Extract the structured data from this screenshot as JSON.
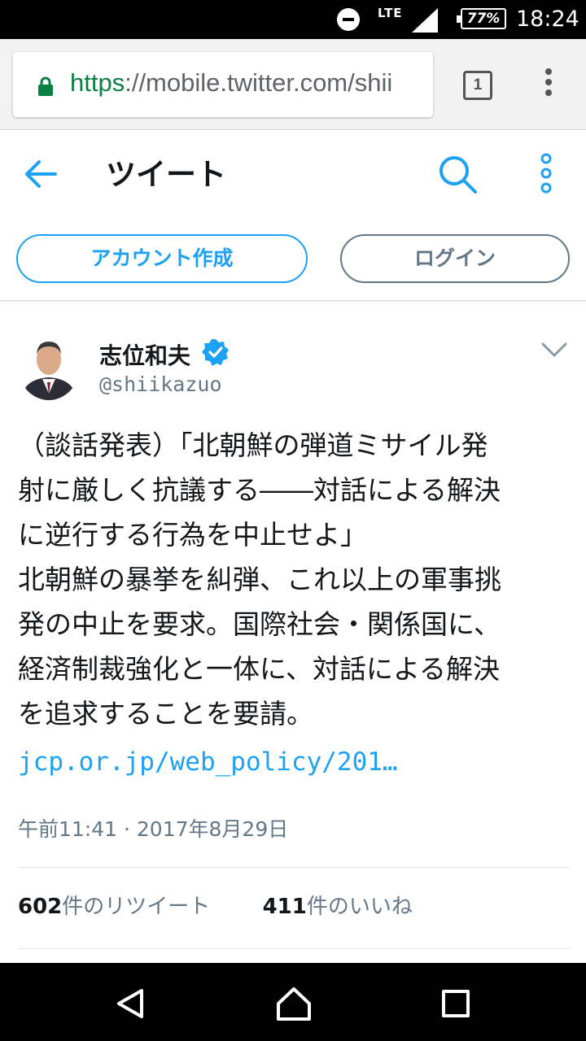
{
  "status_bar": {
    "network": "LTE",
    "battery": "77%",
    "time": "18:24"
  },
  "browser": {
    "url_scheme": "https",
    "url_rest": "://mobile.twitter.com/shii",
    "tab_count": "1"
  },
  "header": {
    "title": "ツイート"
  },
  "auth": {
    "signup_label": "アカウント作成",
    "login_label": "ログイン"
  },
  "tweet": {
    "display_name": "志位和夫",
    "handle": "@shiikazuo",
    "verified": true,
    "text_lines": [
      "（談話発表）「北朝鮮の弾道ミサイル発",
      "射に厳しく抗議する――対話による解決",
      "に逆行する行為を中止せよ」",
      "北朝鮮の暴挙を糾弾、これ以上の軍事挑",
      "発の中止を要求。国際社会・関係国に、",
      "経済制裁強化と一体に、対話による解決",
      "を追求することを要請。"
    ],
    "link": "jcp.or.jp/web_policy/201…",
    "timestamp": "午前11:41 · 2017年8月29日",
    "retweet_count": "602",
    "retweet_label": "件のリツイート",
    "like_count": "411",
    "like_label": "件のいいね"
  },
  "colors": {
    "accent": "#1da1f2",
    "secondary_text": "#657786",
    "url_green": "#0b8043"
  },
  "icons": [
    "lock-icon",
    "back-arrow-icon",
    "search-icon",
    "more-vertical-icon",
    "verified-badge-icon",
    "chevron-down-icon",
    "nav-back-icon",
    "nav-home-icon",
    "nav-recents-icon"
  ]
}
